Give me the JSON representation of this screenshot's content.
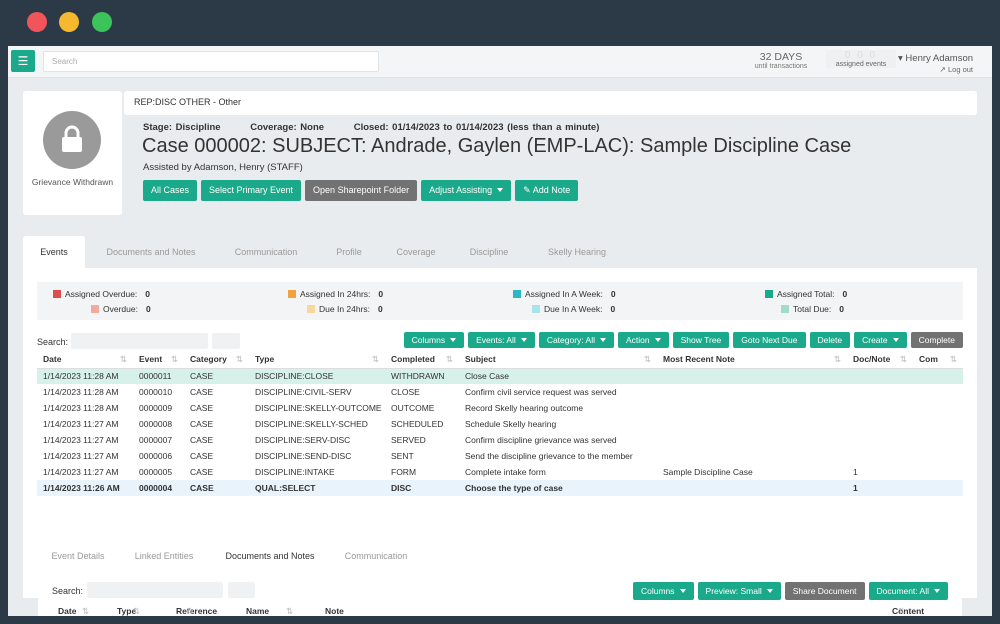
{
  "topbar": {
    "search_placeholder": "Search",
    "days_count": "32 DAYS",
    "days_sub": "until transactions",
    "assigned_boxes": "0 0 0",
    "assigned_sub": "assigned events",
    "user_name": "Henry Adamson",
    "logout": "Log out"
  },
  "case": {
    "rep_line": "REP:DISC OTHER - Other",
    "status": "Grievance Withdrawn",
    "stage": "Stage: Discipline",
    "coverage": "Coverage: None",
    "closed": "Closed: 01/14/2023 to 01/14/2023 (less than a minute)",
    "title": "Case 000002: SUBJECT: Andrade, Gaylen (EMP-LAC): Sample Discipline Case",
    "assisted": "Assisted by Adamson, Henry (STAFF)",
    "actions": {
      "all_cases": "All Cases",
      "select_primary": "Select Primary Event",
      "sharepoint": "Open Sharepoint Folder",
      "adjust": "Adjust Assisting",
      "add_note": "Add Note"
    }
  },
  "tabs": [
    "Events",
    "Documents and Notes",
    "Communication",
    "Profile",
    "Coverage",
    "Discipline",
    "Skelly Hearing"
  ],
  "stats": [
    {
      "label": "Assigned Overdue:",
      "value": "0",
      "color": "#e04b4b"
    },
    {
      "label": "Overdue:",
      "value": "0",
      "color": "#f3a9a0"
    },
    {
      "label": "Assigned In 24hrs:",
      "value": "0",
      "color": "#f0a23e"
    },
    {
      "label": "Due In 24hrs:",
      "value": "0",
      "color": "#f7d79c"
    },
    {
      "label": "Assigned In A Week:",
      "value": "0",
      "color": "#2bb7c6"
    },
    {
      "label": "Due In A Week:",
      "value": "0",
      "color": "#a9e4ea"
    },
    {
      "label": "Assigned Total:",
      "value": "0",
      "color": "#1aa98a"
    },
    {
      "label": "Total Due:",
      "value": "0",
      "color": "#9fddc9"
    }
  ],
  "toolbar": {
    "search_label": "Search:",
    "columns": "Columns",
    "events_all": "Events: All",
    "category_all": "Category: All",
    "action": "Action",
    "show_tree": "Show Tree",
    "next_due": "Goto Next Due",
    "delete": "Delete",
    "create": "Create",
    "complete": "Complete"
  },
  "events_table": {
    "headers": [
      "Date",
      "Event",
      "Category",
      "Type",
      "Completed",
      "Subject",
      "Most Recent Note",
      "Doc/Note",
      "Com"
    ],
    "rows": [
      [
        "1/14/2023 11:28 AM",
        "0000011",
        "CASE",
        "DISCIPLINE:CLOSE",
        "WITHDRAWN",
        "Close Case",
        "",
        "",
        ""
      ],
      [
        "1/14/2023 11:28 AM",
        "0000010",
        "CASE",
        "DISCIPLINE:CIVIL-SERV",
        "CLOSE",
        "Confirm civil service request was served",
        "",
        "",
        ""
      ],
      [
        "1/14/2023 11:28 AM",
        "0000009",
        "CASE",
        "DISCIPLINE:SKELLY-OUTCOME",
        "OUTCOME",
        "Record Skelly hearing outcome",
        "",
        "",
        ""
      ],
      [
        "1/14/2023 11:27 AM",
        "0000008",
        "CASE",
        "DISCIPLINE:SKELLY-SCHED",
        "SCHEDULED",
        "Schedule Skelly hearing",
        "",
        "",
        ""
      ],
      [
        "1/14/2023 11:27 AM",
        "0000007",
        "CASE",
        "DISCIPLINE:SERV-DISC",
        "SERVED",
        "Confirm discipline grievance was served",
        "",
        "",
        ""
      ],
      [
        "1/14/2023 11:27 AM",
        "0000006",
        "CASE",
        "DISCIPLINE:SEND-DISC",
        "SENT",
        "Send the discipline grievance to the member",
        "",
        "",
        ""
      ],
      [
        "1/14/2023 11:27 AM",
        "0000005",
        "CASE",
        "DISCIPLINE:INTAKE",
        "FORM",
        "Complete intake form",
        "Sample Discipline Case",
        "1",
        ""
      ],
      [
        "1/14/2023 11:26 AM",
        "0000004",
        "CASE",
        "QUAL:SELECT",
        "DISC",
        "Choose the type of case",
        "",
        "1",
        ""
      ]
    ]
  },
  "bottom_tabs": [
    "Event Details",
    "Linked Entities",
    "Documents and Notes",
    "Communication"
  ],
  "bottom": {
    "search_label": "Search:",
    "columns": "Columns",
    "preview_small": "Preview: Small",
    "share": "Share Document",
    "document_all": "Document: All",
    "headers": [
      "Date",
      "Type",
      "Reference",
      "Name",
      "Note",
      "Content"
    ]
  }
}
